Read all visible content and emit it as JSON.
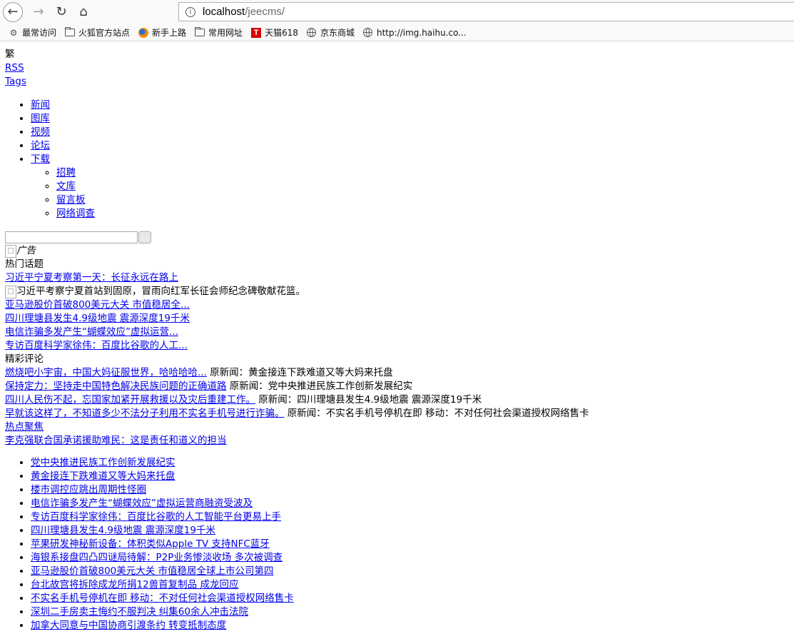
{
  "browser": {
    "url_host": "localhost",
    "url_path": "/jeecms/",
    "bookmarks": [
      {
        "icon": "gear-icon",
        "label": "最常访问"
      },
      {
        "icon": "folder-icon",
        "label": "火狐官方站点"
      },
      {
        "icon": "firefox-icon",
        "label": "新手上路"
      },
      {
        "icon": "folder-icon",
        "label": "常用网址"
      },
      {
        "icon": "tmall-icon",
        "label": "天猫618",
        "icon_text": "T"
      },
      {
        "icon": "globe-icon",
        "label": "京东商城"
      },
      {
        "icon": "globe-icon",
        "label": "http://img.haihu.co..."
      }
    ]
  },
  "header": {
    "traditional": "繁",
    "rss": "RSS",
    "tags": "Tags"
  },
  "nav": {
    "items": [
      "新闻",
      "图库",
      "视频",
      "论坛",
      "下载"
    ],
    "sub_items": [
      "招聘",
      "文库",
      "留言板",
      "网络调查"
    ]
  },
  "search": {
    "placeholder": ""
  },
  "ad": {
    "label": "广告"
  },
  "hot_topics": {
    "title": "热门话题",
    "headline": "习近平宁夏考察第一天：长征永远在路上",
    "caption": "习近平考察宁夏首站到固原，冒雨向红军长征会师纪念碑敬献花篮。",
    "links": [
      "亚马逊股价首破800美元大关 市值稳居全...",
      "四川理塘县发生4.9级地震 震源深度19千米",
      "电信诈骗多发产生“蝴蝶效应”虚拟运营...",
      "专访百度科学家徐伟：百度比谷歌的人工..."
    ]
  },
  "comments": {
    "title": "精彩评论",
    "items": [
      {
        "link": "燃烧吧小宇宙，中国大妈征服世界，哈哈哈哈...",
        "source": " 原新闻：黄金接连下跌难道又等大妈来托盘"
      },
      {
        "link": "保持定力：坚持走中国特色解决民族问题的正确道路",
        "source": " 原新闻：党中央推进民族工作创新发展纪实"
      },
      {
        "link": "四川人民伤不起，忘国家加紧开展救援以及灾后重建工作。",
        "source": " 原新闻：四川理塘县发生4.9级地震 震源深度19千米"
      },
      {
        "link": "早就该这样了，不知道多少不法分子利用不实名手机号进行诈骗。",
        "source": " 原新闻：不实名手机号停机在即 移动：不对任何社会渠道授权网络售卡"
      }
    ]
  },
  "focus": {
    "title": "热点聚焦",
    "headline": "李克强联合国承诺援助难民：这是责任和道义的担当",
    "items": [
      "党中央推进民族工作创新发展纪实",
      "黄金接连下跌难道又等大妈来托盘",
      "楼市调控应跳出周期性怪圈",
      "电信诈骗多发产生“蝴蝶效应”虚拟运营商融资受波及",
      "专访百度科学家徐伟：百度比谷歌的人工智能平台更易上手",
      "四川理塘县发生4.9级地震 震源深度19千米",
      "苹果研发神秘新设备：体积类似Apple TV 支持NFC蓝牙",
      "海银系接盘四凸四谜局待解：P2P业务惨淡收场 多次被调查",
      "亚马逊股价首破800美元大关 市值稳居全球上市公司第四",
      "台北故宫将拆除成龙所捐12兽首复制品 成龙回应",
      "不实名手机号停机在即 移动：不对任何社会渠道授权网络售卡",
      "深圳二手房卖主悔约不服判决 纠集60余人冲击法院",
      "加拿大同意与中国协商引渡条约 转变抵制态度"
    ]
  }
}
